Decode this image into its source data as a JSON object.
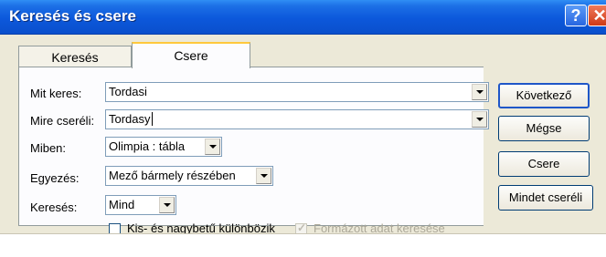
{
  "window": {
    "title": "Keresés és csere",
    "help_glyph": "?",
    "close_glyph": "✕"
  },
  "tabs": [
    {
      "label": "Keresés"
    },
    {
      "label": "Csere"
    }
  ],
  "form": {
    "find_label": "Mit keres:",
    "find_value": "Tordasi",
    "replace_label": "Mire cseréli:",
    "replace_value": "Tordasy",
    "look_in_label": "Miben:",
    "look_in_value": "Olimpia : tábla",
    "match_label": "Egyezés:",
    "match_value": "Mező bármely részében",
    "search_label": "Keresés:",
    "search_value": "Mind",
    "match_case_label": "Kis- és nagybetű különbözik",
    "formatted_label": "Formázott adat keresése"
  },
  "buttons": {
    "next": "Következő",
    "cancel": "Mégse",
    "replace": "Csere",
    "replace_all": "Mindet cseréli"
  },
  "state": {
    "active_tab": "Csere",
    "match_case_checked": false,
    "formatted_checked": true,
    "formatted_enabled": false
  },
  "colors": {
    "titlebar": "#0a4fcc",
    "dialog_bg": "#ece9d8",
    "panel_bg": "#fcfcfe"
  }
}
